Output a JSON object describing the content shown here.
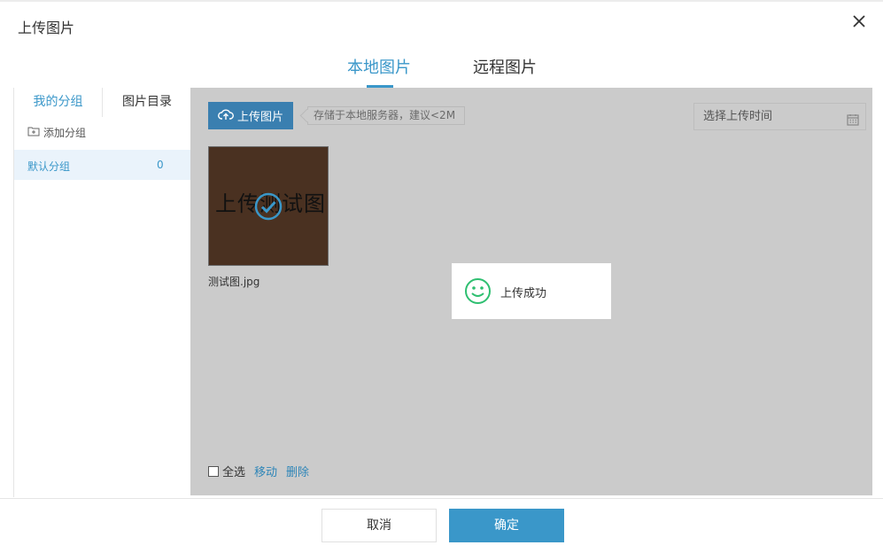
{
  "dialog": {
    "title": "上传图片"
  },
  "tabs": {
    "local": "本地图片",
    "remote": "远程图片"
  },
  "sidebar": {
    "tabs": [
      "我的分组",
      "图片目录"
    ],
    "add_group": "添加分组",
    "groups": [
      {
        "name": "默认分组",
        "count": "0"
      }
    ]
  },
  "toolbar": {
    "upload_label": "上传图片",
    "hint": "存储于本地服务器，建议<2M",
    "date_placeholder": "选择上传时间"
  },
  "images": [
    {
      "thumb_text": "上传测试图",
      "name": "测试图.jpg",
      "selected": true
    }
  ],
  "toast": {
    "text": "上传成功"
  },
  "bulk": {
    "select_all": "全选",
    "move": "移动",
    "delete": "删除"
  },
  "footer": {
    "cancel": "取消",
    "ok": "确定"
  },
  "colors": {
    "accent": "#3a97c9",
    "panel_bg": "#cbcbcb",
    "success": "#2fbf71"
  },
  "icons": [
    "close-icon",
    "cloud-upload-icon",
    "calendar-icon",
    "folder-plus-icon",
    "check-circle-icon",
    "smile-icon"
  ]
}
